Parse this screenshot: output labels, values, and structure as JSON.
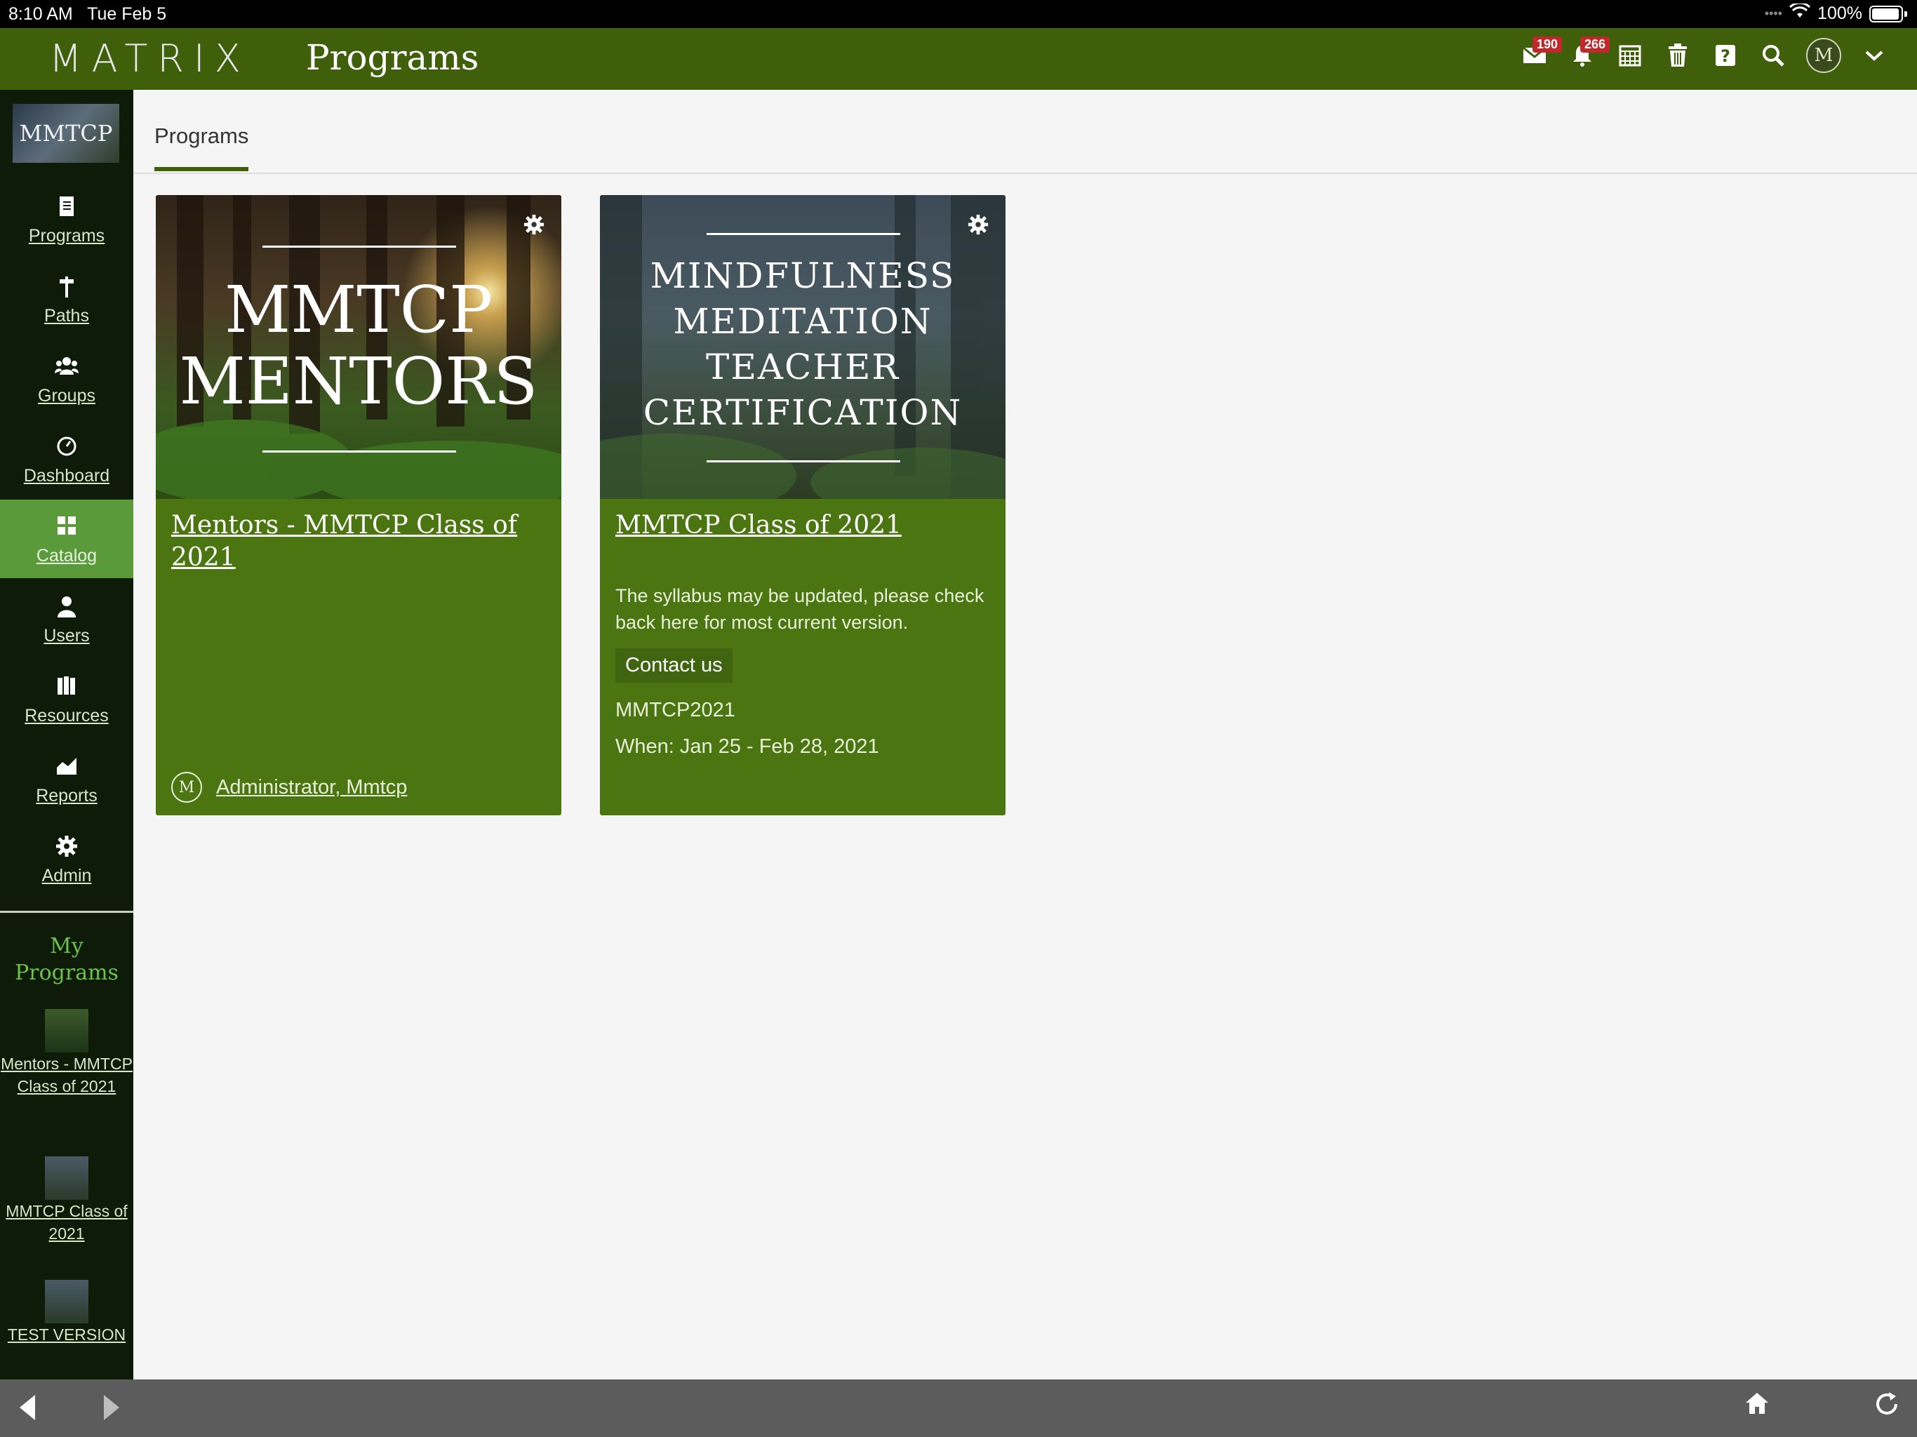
{
  "status_bar": {
    "time": "8:10 AM",
    "date": "Tue Feb 5",
    "battery": "100%"
  },
  "header": {
    "logo": "MATRIX",
    "title": "Programs",
    "icons": [
      {
        "name": "inbox-icon",
        "badge": "190"
      },
      {
        "name": "notifications-icon",
        "badge": "266"
      },
      {
        "name": "calendar-icon"
      },
      {
        "name": "trash-icon"
      },
      {
        "name": "help-icon"
      },
      {
        "name": "search-icon"
      },
      {
        "name": "user-avatar"
      },
      {
        "name": "chevron-down-icon"
      }
    ]
  },
  "sidebar": {
    "logo_text": "MMTCP",
    "items": [
      {
        "label": "Programs",
        "icon": "book-icon"
      },
      {
        "label": "Paths",
        "icon": "signpost-icon"
      },
      {
        "label": "Groups",
        "icon": "users-group-icon"
      },
      {
        "label": "Dashboard",
        "icon": "dashboard-icon"
      },
      {
        "label": "Catalog",
        "icon": "grid-icon",
        "active": true
      },
      {
        "label": "Users",
        "icon": "user-icon"
      },
      {
        "label": "Resources",
        "icon": "books-icon"
      },
      {
        "label": "Reports",
        "icon": "chart-icon"
      },
      {
        "label": "Admin",
        "icon": "gear-icon"
      }
    ],
    "my_programs_heading": "My Programs",
    "my_programs": [
      {
        "label": "Mentors - MMTCP Class of 2021"
      },
      {
        "label": "MMTCP Class of 2021"
      },
      {
        "label": "TEST VERSION"
      }
    ]
  },
  "tabs": {
    "active": "Programs"
  },
  "cards": [
    {
      "hero_line1": "MMTCP",
      "hero_line2": "MENTORS",
      "title": "Mentors - MMTCP Class of 2021",
      "author": "Administrator, Mmtcp"
    },
    {
      "hero_lines": [
        "MINDFULNESS",
        "MEDITATION",
        "TEACHER",
        "CERTIFICATION"
      ],
      "title": "MMTCP Class of 2021",
      "description": "The syllabus may be updated, please check back here for most current version.",
      "contact": "Contact us",
      "code": "MMTCP2021",
      "when": "When: Jan 25 - Feb 28, 2021"
    }
  ],
  "colors": {
    "header": "#3f5f0a",
    "card": "#4a7510",
    "sidebar": "#0e1b08",
    "active": "#5a9a3a",
    "accent_text": "#6ec24a"
  }
}
